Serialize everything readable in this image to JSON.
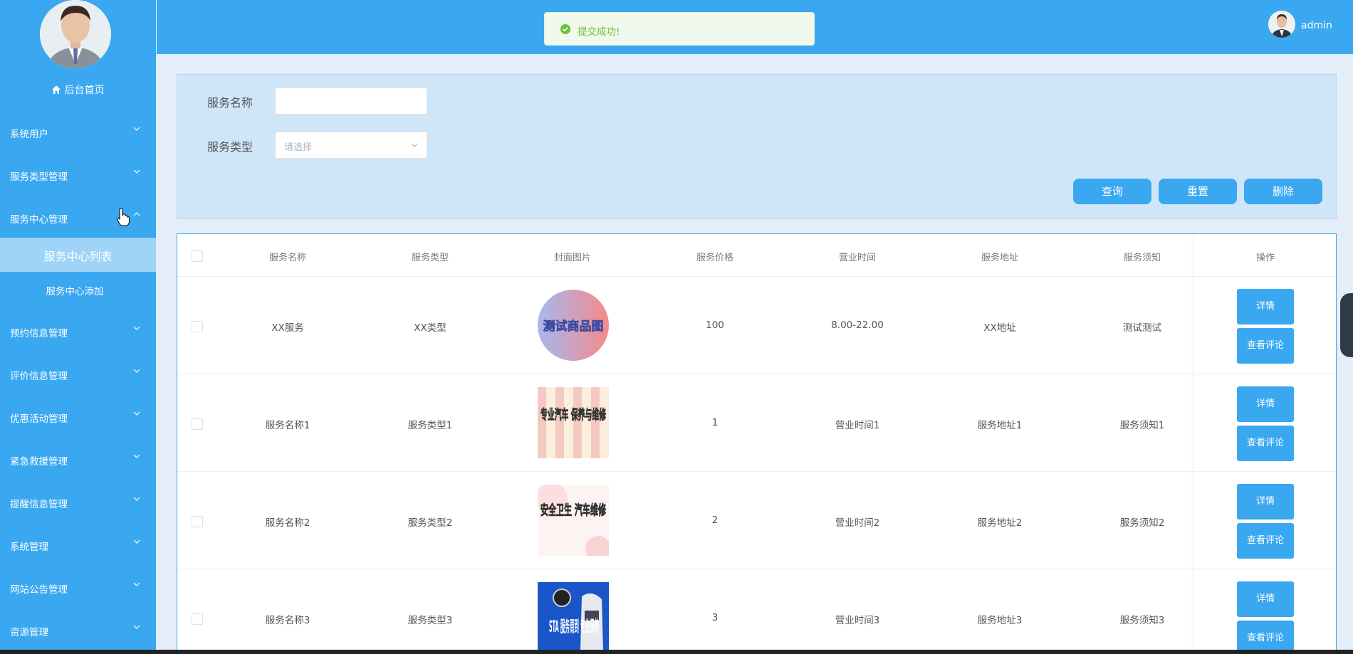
{
  "sidebar": {
    "home_label": "后台首页",
    "menu": [
      {
        "label": "系统用户"
      },
      {
        "label": "服务类型管理"
      },
      {
        "label": "服务中心管理"
      },
      {
        "label": "预约信息管理"
      },
      {
        "label": "评价信息管理"
      },
      {
        "label": "优惠活动管理"
      },
      {
        "label": "紧急救援管理"
      },
      {
        "label": "提醒信息管理"
      },
      {
        "label": "系统管理"
      },
      {
        "label": "网站公告管理"
      },
      {
        "label": "资源管理"
      }
    ],
    "submenu": {
      "active": "服务中心列表",
      "item": "服务中心添加"
    }
  },
  "topbar": {
    "toast": "提交成功!",
    "username": "admin"
  },
  "filter": {
    "name_label": "服务名称",
    "name_value": "",
    "type_label": "服务类型",
    "type_placeholder": "请选择",
    "query_button": "查询",
    "reset_button": "重置",
    "delete_button": "删除"
  },
  "table": {
    "headers": [
      "服务名称",
      "服务类型",
      "封面图片",
      "服务价格",
      "营业时间",
      "服务地址",
      "服务须知",
      "操作"
    ],
    "rows": [
      {
        "name": "XX服务",
        "type": "XX类型",
        "image_text": "测试商品图",
        "price": "100",
        "hours": "8.00-22.00",
        "address": "XX地址",
        "notice": "测试测试"
      },
      {
        "name": "服务名称1",
        "type": "服务类型1",
        "image_text": "专业汽车 保养与维修",
        "price": "1",
        "hours": "营业时间1",
        "address": "服务地址1",
        "notice": "服务须知1"
      },
      {
        "name": "服务名称2",
        "type": "服务类型2",
        "image_text": "安全卫生 汽车维修",
        "price": "2",
        "hours": "营业时间2",
        "address": "服务地址2",
        "notice": "服务须知2"
      },
      {
        "name": "服务名称3",
        "type": "服务类型3",
        "image_text": "STA 服务周到 专业保养",
        "price": "3",
        "hours": "营业时间3",
        "address": "服务地址3",
        "notice": "服务须知3"
      }
    ],
    "detail_button": "详情",
    "review_button": "查看评论"
  },
  "colors": {
    "primary": "#3aa7f1",
    "success": "#67c23a"
  }
}
